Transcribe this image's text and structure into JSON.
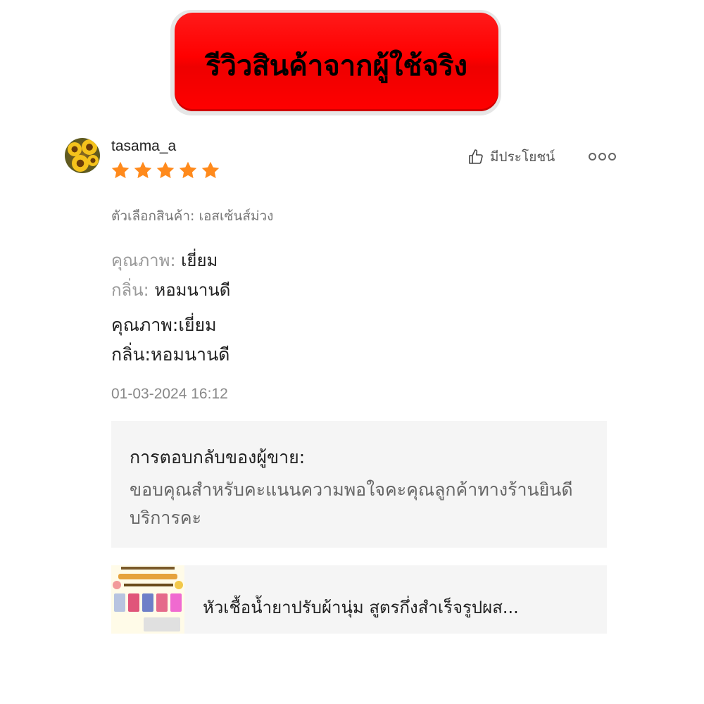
{
  "banner": {
    "title": "รีวิวสินค้าจากผู้ใช้จริง"
  },
  "review": {
    "username": "tasama_a",
    "rating": 5,
    "rating_max": 5,
    "helpful_label": "มีประโยชน์",
    "variation": "ตัวเลือกสินค้า: เอสเซ้นส์ม่วง",
    "attributes": [
      {
        "label": "คุณภาพ:",
        "value": "เยี่ยม"
      },
      {
        "label": "กลิ่น:",
        "value": "หอมนานดี"
      }
    ],
    "body_lines": [
      "คุณภาพ:เยี่ยม",
      "กลิ่น:หอมนานดี"
    ],
    "timestamp": "01-03-2024 16:12"
  },
  "seller_reply": {
    "title": "การตอบกลับของผู้ขาย:",
    "body": "ขอบคุณสำหรับคะแนนความพอใจคะคุณลูกค้าทางร้านยินดีบริการคะ"
  },
  "product": {
    "title": "หัวเชื้อน้ำยาปรับผ้านุ่ม สูตรกึ่งสำเร็จรูปผส..."
  },
  "colors": {
    "banner_red": "#ff0000",
    "star_orange": "#ff8a1c",
    "reply_bg": "#f5f5f5"
  },
  "icons": {
    "thumb": "thumbs-up-icon",
    "more": "more-options-icon",
    "star": "star-icon"
  }
}
